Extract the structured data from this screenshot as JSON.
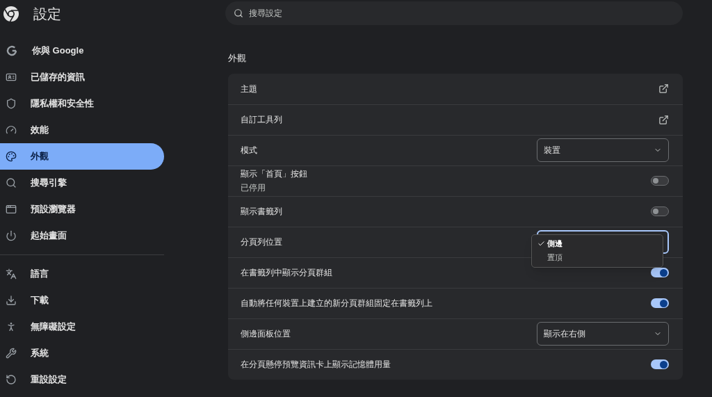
{
  "header": {
    "title": "設定"
  },
  "search": {
    "placeholder": "搜尋設定"
  },
  "sidebar": {
    "groups": [
      [
        {
          "label": "你與 Google",
          "selected": false
        },
        {
          "label": "已儲存的資訊",
          "selected": false
        },
        {
          "label": "隱私權和安全性",
          "selected": false
        },
        {
          "label": "效能",
          "selected": false
        },
        {
          "label": "外觀",
          "selected": true
        },
        {
          "label": "搜尋引擎",
          "selected": false
        },
        {
          "label": "預設瀏覽器",
          "selected": false
        },
        {
          "label": "起始畫面",
          "selected": false
        }
      ],
      [
        {
          "label": "語言",
          "selected": false
        },
        {
          "label": "下載",
          "selected": false
        },
        {
          "label": "無障礙設定",
          "selected": false
        },
        {
          "label": "系統",
          "selected": false
        },
        {
          "label": "重設設定",
          "selected": false
        }
      ]
    ]
  },
  "section": {
    "title": "外觀",
    "rows": [
      {
        "kind": "link",
        "label": "主題"
      },
      {
        "kind": "link",
        "label": "自訂工具列"
      },
      {
        "kind": "select",
        "label": "模式",
        "value": "裝置"
      },
      {
        "kind": "toggle",
        "label": "顯示「首頁」按鈕",
        "sublabel": "已停用",
        "on": false
      },
      {
        "kind": "toggle",
        "label": "顯示書籤列",
        "on": false
      },
      {
        "kind": "select",
        "label": "分頁列位置",
        "expanded": true,
        "options": [
          {
            "label": "側邊",
            "selected": true
          },
          {
            "label": "置頂",
            "selected": false
          }
        ]
      },
      {
        "kind": "toggle",
        "label": "在書籤列中顯示分頁群組",
        "on": true
      },
      {
        "kind": "toggle",
        "label": "自動將任何裝置上建立的新分頁群組固定在書籤列上",
        "on": true
      },
      {
        "kind": "select",
        "label": "側邊面板位置",
        "value": "顯示在右側"
      },
      {
        "kind": "toggle",
        "label": "在分頁懸停預覽資訊卡上顯示記憶體用量",
        "on": true
      }
    ]
  }
}
